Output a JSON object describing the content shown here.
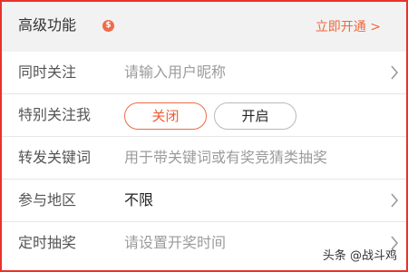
{
  "header": {
    "title": "高级功能",
    "badge": "$",
    "link": "立即开通 >"
  },
  "rows": [
    {
      "label": "同时关注",
      "placeholder": "请输入用户昵称",
      "chevron": "chevron-right-icon"
    },
    {
      "label": "特别关注我",
      "options": [
        "关闭",
        "开启"
      ],
      "selected": "关闭"
    },
    {
      "label": "转发关键词",
      "placeholder": "用于带关键词或有奖竞猜类抽奖"
    },
    {
      "label": "参与地区",
      "value": "不限",
      "chevron": "chevron-right-icon"
    },
    {
      "label": "定时抽奖",
      "placeholder": "请设置开奖时间",
      "chevron": "chevron-right-icon"
    }
  ],
  "watermark": "头条 @战斗鸡",
  "colors": {
    "accent": "#ef5b35",
    "border": "#e8322b"
  }
}
